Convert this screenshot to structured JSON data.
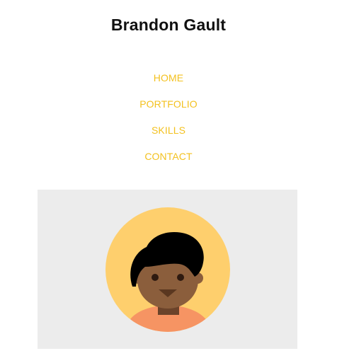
{
  "header": {
    "title": "Brandon Gault"
  },
  "nav": {
    "items": [
      {
        "label": "HOME"
      },
      {
        "label": "PORTFOLIO"
      },
      {
        "label": "SKILLS"
      },
      {
        "label": "CONTACT"
      }
    ]
  },
  "colors": {
    "accent": "#f3c11f",
    "hero_background": "#ececec",
    "avatar_circle": "#fecf6d",
    "skin": "#8b5e3c",
    "hair": "#000000",
    "shirt": "#f69463"
  }
}
